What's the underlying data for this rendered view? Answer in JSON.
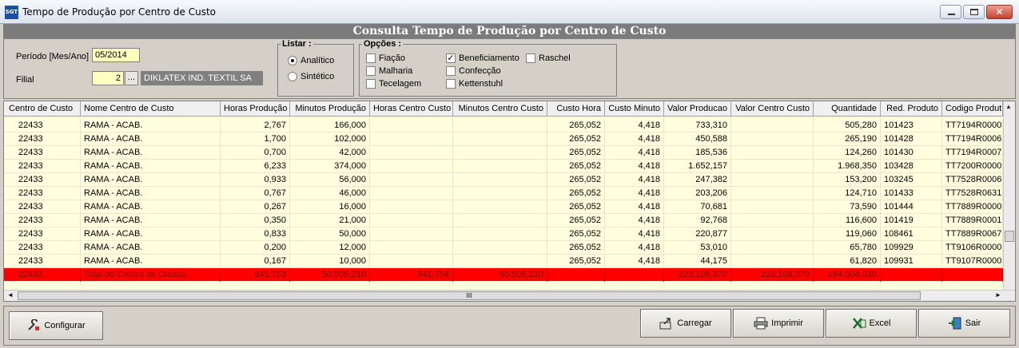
{
  "window": {
    "icon_text": "SGT",
    "title": "Tempo de Produção por Centro de Custo",
    "close_glyph": "✕"
  },
  "header": {
    "title": "Consulta Tempo de Produção por Centro de Custo"
  },
  "filters": {
    "periodo_label": "Período [Mes/Ano]",
    "periodo_value": "05/2014",
    "filial_label": "Filial",
    "filial_value": "2",
    "filial_ellipsis": "...",
    "filial_name": "DIKLATEX IND. TEXTIL SA"
  },
  "listar": {
    "title": "Listar :",
    "options": [
      {
        "label": "Analítico",
        "selected": true
      },
      {
        "label": "Sintético",
        "selected": false
      }
    ]
  },
  "opcoes": {
    "title": "Opções :",
    "items": [
      {
        "label": "Fiação",
        "checked": false,
        "mark": ""
      },
      {
        "label": "Malharia",
        "checked": false,
        "mark": ""
      },
      {
        "label": "Tecelagem",
        "checked": false,
        "mark": ""
      },
      {
        "label": "Beneficiamento",
        "checked": true,
        "mark": "✓"
      },
      {
        "label": "Confecção",
        "checked": false,
        "mark": ""
      },
      {
        "label": "Kettenstuhl",
        "checked": false,
        "mark": ""
      },
      {
        "label": "Raschel",
        "checked": false,
        "mark": ""
      }
    ]
  },
  "grid": {
    "columns": [
      "Centro de Custo",
      "Nome Centro de Custo",
      "Horas Produção",
      "Minutos Produção",
      "Horas Centro Custo",
      "Minutos Centro Custo",
      "Custo Hora",
      "Custo Minuto",
      "Valor Producao",
      "Valor Centro Custo",
      "Quantidade",
      "Red. Produto",
      "Codigo Produt"
    ],
    "rows": [
      [
        "22433",
        "RAMA - ACAB.",
        "2,767",
        "166,000",
        "",
        "",
        "265,052",
        "4,418",
        "733,310",
        "",
        "505,280",
        "101423",
        "TT7194R0000"
      ],
      [
        "22433",
        "RAMA - ACAB.",
        "1,700",
        "102,000",
        "",
        "",
        "265,052",
        "4,418",
        "450,588",
        "",
        "265,190",
        "101428",
        "TT7194R0006"
      ],
      [
        "22433",
        "RAMA - ACAB.",
        "0,700",
        "42,000",
        "",
        "",
        "265,052",
        "4,418",
        "185,536",
        "",
        "124,260",
        "101430",
        "TT7194R0007"
      ],
      [
        "22433",
        "RAMA - ACAB.",
        "6,233",
        "374,000",
        "",
        "",
        "265,052",
        "4,418",
        "1.652,157",
        "",
        "1.968,350",
        "103428",
        "TT7200R0000"
      ],
      [
        "22433",
        "RAMA - ACAB.",
        "0,933",
        "56,000",
        "",
        "",
        "265,052",
        "4,418",
        "247,382",
        "",
        "153,200",
        "103245",
        "TT7528R0006"
      ],
      [
        "22433",
        "RAMA - ACAB.",
        "0,767",
        "46,000",
        "",
        "",
        "265,052",
        "4,418",
        "203,206",
        "",
        "124,710",
        "101433",
        "TT7528R0631"
      ],
      [
        "22433",
        "RAMA - ACAB.",
        "0,267",
        "16,000",
        "",
        "",
        "265,052",
        "4,418",
        "70,681",
        "",
        "73,590",
        "101444",
        "TT7889R0000"
      ],
      [
        "22433",
        "RAMA - ACAB.",
        "0,350",
        "21,000",
        "",
        "",
        "265,052",
        "4,418",
        "92,768",
        "",
        "116,600",
        "101419",
        "TT7889R0001"
      ],
      [
        "22433",
        "RAMA - ACAB.",
        "0,833",
        "50,000",
        "",
        "",
        "265,052",
        "4,418",
        "220,877",
        "",
        "119,060",
        "108461",
        "TT7889R0067"
      ],
      [
        "22433",
        "RAMA - ACAB.",
        "0,200",
        "12,000",
        "",
        "",
        "265,052",
        "4,418",
        "53,010",
        "",
        "65,780",
        "109929",
        "TT9106R0000"
      ],
      [
        "22433",
        "RAMA - ACAB.",
        "0,167",
        "10,000",
        "",
        "",
        "265,052",
        "4,418",
        "44,175",
        "",
        "61,820",
        "109931",
        "TT9107R0000"
      ]
    ],
    "total": [
      "22433",
      "Total do Centro de Custos",
      "841,753",
      "50.505,210",
      "841,754",
      "50.505,210",
      "",
      "",
      "223.108,370",
      "223.108,370",
      "184.004,030",
      "",
      ""
    ],
    "hscroll_grip": "III",
    "arrow_left": "◄",
    "arrow_right": "►",
    "arrow_up": "▲"
  },
  "footer": {
    "configurar": "Configurar",
    "carregar": "Carregar",
    "imprimir": "Imprimir",
    "excel": "Excel",
    "sair": "Sair"
  },
  "colors": {
    "total_row": "#ff0000",
    "grid_row": "#ffffe0",
    "header_band": "#7b7b7b",
    "input_bg": "#ffffc0"
  }
}
